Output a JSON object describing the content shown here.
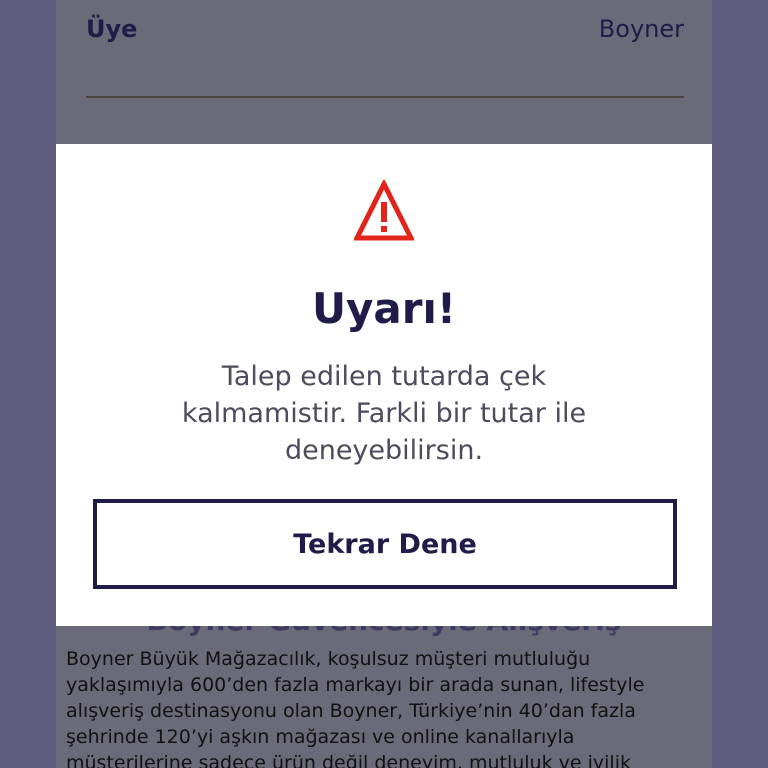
{
  "header": {
    "left_label": "Üye",
    "right_label": "Boyner"
  },
  "background": {
    "heading": "Boyner Güvencesiyle Alışveriş",
    "text_lines": [
      "Boyner Büyük Mağazacılık, koşulsuz müşteri mutluluğu",
      "yaklaşımıyla 600’den fazla markayı bir arada sunan, lifestyle",
      "alışveriş destinasyonu olan Boyner, Türkiye’nin 40’dan fazla",
      "şehrinde 120’yi aşkın mağazası ve online kanallarıyla",
      "müşterilerine sadece ürün değil deneyim, mutluluk ve iyilik"
    ]
  },
  "modal": {
    "icon": "warning-icon",
    "title": "Uyarı!",
    "message": "Talep edilen tutarda çek kalmamistir. Farkli bir tutar ile deneyebilirsin.",
    "button_label": "Tekrar Dene"
  },
  "colors": {
    "overlay": "#5f5b7e",
    "brand_navy": "#1f1c4a",
    "warning_red": "#e1251b",
    "modal_bg": "#ffffff"
  }
}
